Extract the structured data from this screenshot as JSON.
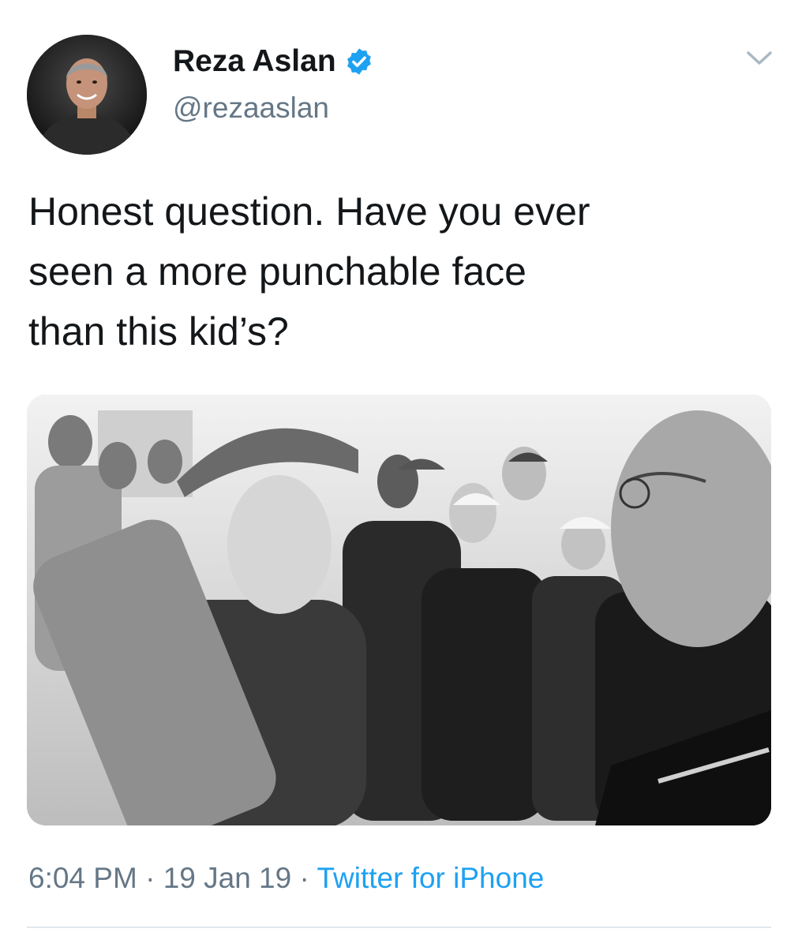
{
  "author": {
    "name": "Reza Aslan",
    "handle": "@rezaaslan",
    "verified": true,
    "avatar_icon": "profile-photo"
  },
  "tweet": {
    "text": "Honest question. Have you ever\nseen a more punchable face\nthan this kid’s?",
    "media_icon": "attached-photo"
  },
  "meta": {
    "time": "6:04 PM",
    "sep1": " · ",
    "date": "19 Jan 19",
    "sep2": " · ",
    "source": "Twitter for iPhone"
  },
  "colors": {
    "primary_text": "#14171a",
    "secondary_text": "#657786",
    "link": "#1da1f2",
    "verified_badge": "#1da1f2",
    "divider": "#e1e8ed"
  }
}
